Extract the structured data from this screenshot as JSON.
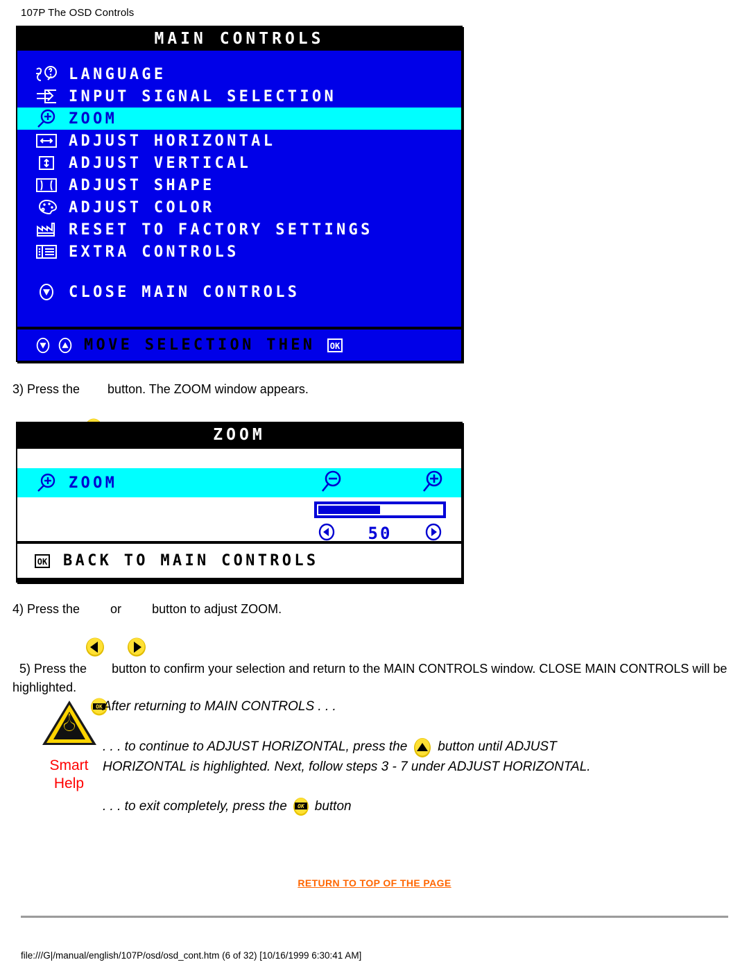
{
  "page": {
    "header": "107P The OSD Controls",
    "file_path": "file:///G|/manual/english/107P/osd/osd_cont.htm (6 of 32) [10/16/1999 6:30:41 AM]",
    "return_top_link": "RETURN TO TOP OF THE PAGE"
  },
  "colors": {
    "osd_blue": "#0000e8",
    "osd_highlight_cyan": "#00ffff",
    "osd_text_white": "#ffffff",
    "osd_text_blue": "#0000d0",
    "link_orange": "#ff6600",
    "smart_help_red": "#ff0000",
    "button_yellow": "#ffd700"
  },
  "main_controls": {
    "title": "MAIN CONTROLS",
    "items": [
      {
        "label": "LANGUAGE",
        "icon": "language-icon",
        "highlighted": false
      },
      {
        "label": "INPUT SIGNAL SELECTION",
        "icon": "input-signal-icon",
        "highlighted": false
      },
      {
        "label": "ZOOM",
        "icon": "zoom-magnifier-icon",
        "highlighted": true
      },
      {
        "label": "ADJUST HORIZONTAL",
        "icon": "horizontal-arrows-icon",
        "highlighted": false
      },
      {
        "label": "ADJUST VERTICAL",
        "icon": "vertical-arrows-icon",
        "highlighted": false
      },
      {
        "label": "ADJUST SHAPE",
        "icon": "shape-icon",
        "highlighted": false
      },
      {
        "label": "ADJUST COLOR",
        "icon": "color-palette-icon",
        "highlighted": false
      },
      {
        "label": "RESET TO FACTORY SETTINGS",
        "icon": "factory-icon",
        "highlighted": false
      },
      {
        "label": "EXTRA CONTROLS",
        "icon": "list-icon",
        "highlighted": false
      }
    ],
    "close_item": {
      "label": "CLOSE MAIN CONTROLS",
      "icon": "down-arrow-icon"
    },
    "footer": {
      "label": "MOVE SELECTION THEN",
      "icons": [
        "down-arrow-icon",
        "up-arrow-icon",
        "ok-icon"
      ]
    }
  },
  "zoom_window": {
    "title": "ZOOM",
    "row_label": "ZOOM",
    "row_icon": "zoom-magnifier-icon",
    "decrease_icon": "zoom-out-icon",
    "increase_icon": "zoom-in-icon",
    "slider_value": "50",
    "slider_percent": 50,
    "left_arrow_icon": "left-arrow-icon",
    "right_arrow_icon": "right-arrow-icon",
    "footer_label": "BACK TO MAIN CONTROLS",
    "footer_icon": "ok-icon"
  },
  "steps": {
    "step3_a": "3) Press the",
    "step3_b": "button. The ZOOM window appears.",
    "step4_a": "4) Press the",
    "step4_b": "or",
    "step4_c": "button to adjust ZOOM.",
    "step5_a": "5) Press the",
    "step5_b": "button to confirm your selection and return to the MAIN CONTROLS window. CLOSE MAIN CONTROLS will be highlighted."
  },
  "smart_help": {
    "icon": "warning-triangle-icon",
    "label_line1": "Smart",
    "label_line2": "Help",
    "line1": "After returning to MAIN CONTROLS . . .",
    "line2_a": ". . . to continue to ADJUST HORIZONTAL, press the",
    "line2_b": "button until ADJUST",
    "line3": "HORIZONTAL is highlighted. Next, follow steps 3 - 7 under ADJUST HORIZONTAL.",
    "line4_a": ". . . to exit completely, press the",
    "line4_b": "button"
  }
}
